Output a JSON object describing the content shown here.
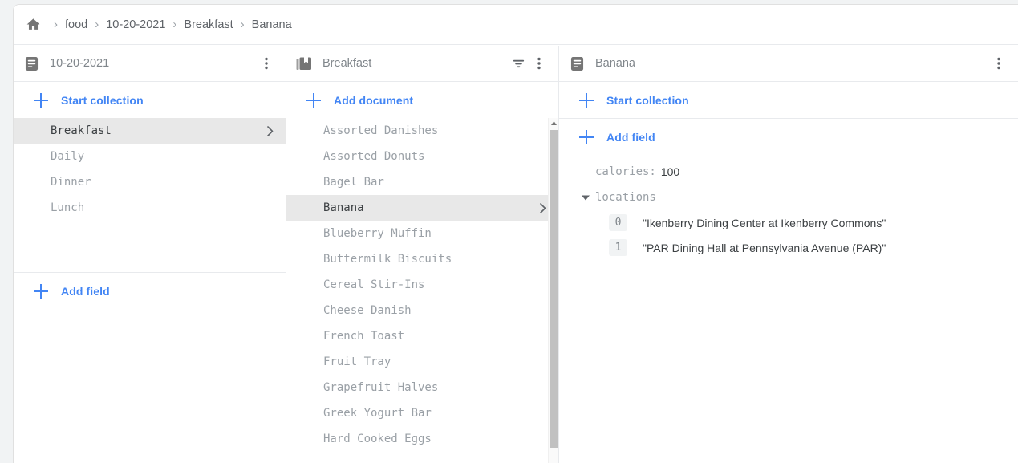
{
  "breadcrumb": {
    "home_icon": "home-icon",
    "separator": "›",
    "items": [
      "food",
      "10-20-2021",
      "Breakfast",
      "Banana"
    ]
  },
  "panels": {
    "collections": {
      "header": {
        "icon": "document-icon",
        "title": "10-20-2021",
        "menu_icon": "more-vert-icon"
      },
      "action": {
        "label": "Start collection",
        "icon": "plus-icon"
      },
      "items": [
        {
          "label": "Breakfast",
          "selected": true
        },
        {
          "label": "Daily",
          "selected": false
        },
        {
          "label": "Dinner",
          "selected": false
        },
        {
          "label": "Lunch",
          "selected": false
        }
      ],
      "footer_action": {
        "label": "Add field",
        "icon": "plus-icon"
      }
    },
    "documents": {
      "header": {
        "icon": "collection-icon",
        "title": "Breakfast",
        "filter_icon": "filter-icon",
        "menu_icon": "more-vert-icon"
      },
      "action": {
        "label": "Add document",
        "icon": "plus-icon"
      },
      "items": [
        {
          "label": "Assorted Danishes",
          "selected": false
        },
        {
          "label": "Assorted Donuts",
          "selected": false
        },
        {
          "label": "Bagel Bar",
          "selected": false
        },
        {
          "label": "Banana",
          "selected": true
        },
        {
          "label": "Blueberry Muffin",
          "selected": false
        },
        {
          "label": "Buttermilk Biscuits",
          "selected": false
        },
        {
          "label": "Cereal Stir-Ins",
          "selected": false
        },
        {
          "label": "Cheese Danish",
          "selected": false
        },
        {
          "label": "French Toast",
          "selected": false
        },
        {
          "label": "Fruit Tray",
          "selected": false
        },
        {
          "label": "Grapefruit Halves",
          "selected": false
        },
        {
          "label": "Greek Yogurt Bar",
          "selected": false
        },
        {
          "label": "Hard Cooked Eggs",
          "selected": false
        }
      ],
      "scrollbar": {
        "up_arrow_icon": "arrow-up-icon"
      }
    },
    "document_detail": {
      "header": {
        "icon": "document-icon",
        "title": "Banana",
        "menu_icon": "more-vert-icon"
      },
      "action_start_collection": {
        "label": "Start collection",
        "icon": "plus-icon"
      },
      "action_add_field": {
        "label": "Add field",
        "icon": "plus-icon"
      },
      "fields": [
        {
          "name": "calories:",
          "value": "100",
          "expandable": false
        },
        {
          "name": "locations",
          "value": "",
          "expandable": true,
          "expanded": true,
          "array": [
            {
              "index": "0",
              "value": "\"Ikenberry Dining Center at Ikenberry Commons\""
            },
            {
              "index": "1",
              "value": "\"PAR Dining Hall at Pennsylvania Avenue (PAR)\""
            }
          ]
        }
      ]
    }
  },
  "colors": {
    "accent_blue": "#4285f4",
    "text_gray": "#5f6368",
    "muted_gray": "#9aa0a6",
    "selected_bg": "#e8e8e8",
    "border": "#e8eaed",
    "page_bg": "#f1f3f4"
  }
}
